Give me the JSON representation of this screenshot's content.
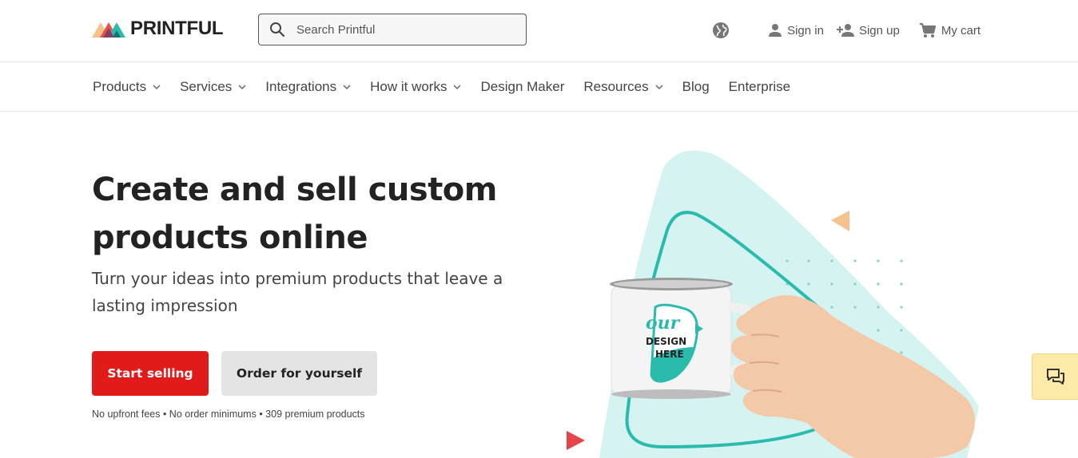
{
  "header": {
    "logo_text": "PRINTFUL",
    "search": {
      "placeholder": "Search Printful"
    },
    "actions": [
      {
        "icon": "globe-icon",
        "label": ""
      },
      {
        "icon": "user-icon",
        "label": "Sign in"
      },
      {
        "icon": "add-user-icon",
        "label": "Sign up"
      },
      {
        "icon": "cart-icon",
        "label": "My cart"
      }
    ]
  },
  "nav": {
    "items": [
      {
        "label": "Products",
        "dropdown": true
      },
      {
        "label": "Services",
        "dropdown": true
      },
      {
        "label": "Integrations",
        "dropdown": true
      },
      {
        "label": "How it works",
        "dropdown": true
      },
      {
        "label": "Design Maker",
        "dropdown": false
      },
      {
        "label": "Resources",
        "dropdown": true
      },
      {
        "label": "Blog",
        "dropdown": false
      },
      {
        "label": "Enterprise",
        "dropdown": false
      }
    ]
  },
  "hero": {
    "title": "Create and sell custom products online",
    "subtitle": "Turn your ideas into premium products that leave a lasting impression",
    "primary_button": "Start selling",
    "secondary_button": "Order for yourself",
    "note": "No upfront fees • No order minimums • 309 premium products",
    "mug_text_line1": "our",
    "mug_text_line2": "DESIGN",
    "mug_text_line3": "HERE"
  },
  "chat": {
    "icon": "chat-icon"
  },
  "colors": {
    "primary": "#e11a1a",
    "teal": "#2bbbad",
    "light_teal": "#d4f3f1",
    "orange": "#f5c28e"
  }
}
